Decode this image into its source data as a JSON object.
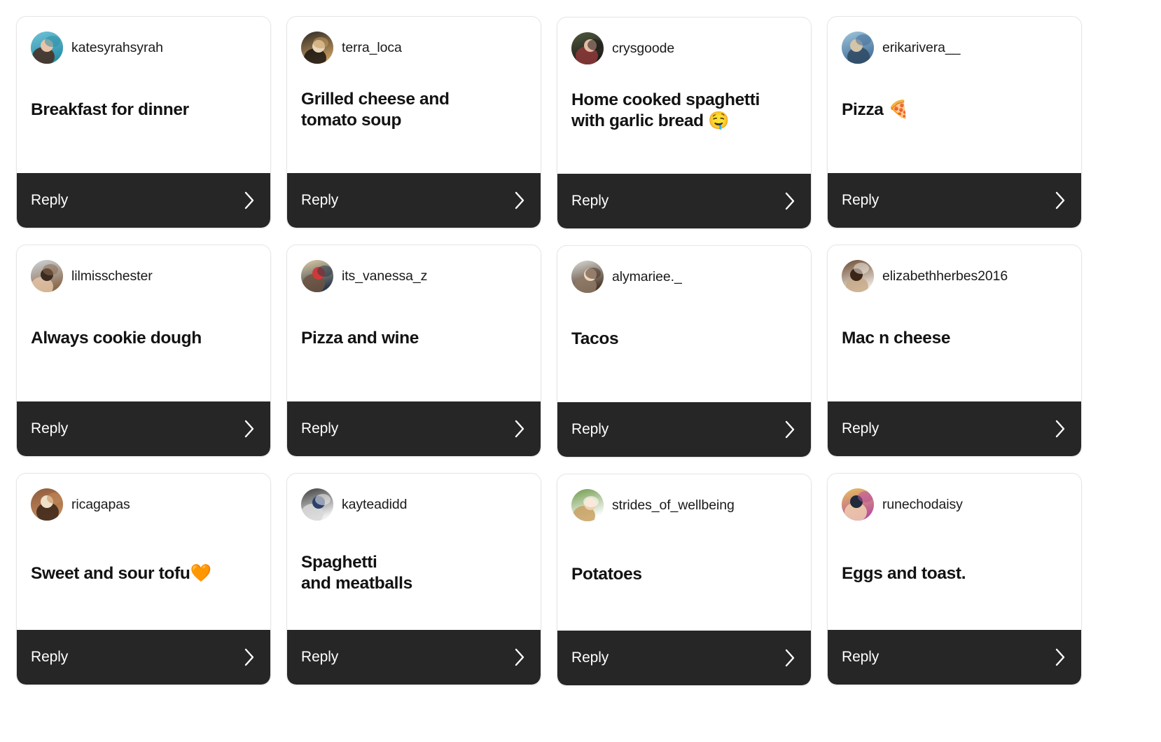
{
  "theme": {
    "page_background": "#ffffff",
    "card_background": "#ffffff",
    "card_border": "#e6e6e6",
    "reply_bar_background": "#262626",
    "reply_label_color": "#ffffff",
    "answer_text_color": "#121212",
    "username_text_color": "#1a1a1a"
  },
  "reply": {
    "label": "Reply",
    "chevron_icon": "chevron-right-icon"
  },
  "grid": {
    "columns": 4,
    "rows": 3,
    "card_count": 12
  },
  "cards": [
    {
      "username": "katesyrahsyrah",
      "answer": "Breakfast for dinner",
      "lines": 1,
      "avatar_icon": "avatar-katesyrahsyrah",
      "avatar_colors": [
        "#6fc3d8",
        "#2b90a8",
        "#e8c4a8",
        "#4a2c1e"
      ]
    },
    {
      "username": "terra_loca",
      "answer": "Grilled cheese and\ntomato soup",
      "lines": 2,
      "avatar_icon": "avatar-terra-loca",
      "avatar_colors": [
        "#2e2a24",
        "#c49a5e",
        "#e8d5b8",
        "#1a1510"
      ]
    },
    {
      "username": "crysgoode",
      "answer": "Home cooked spaghetti\nwith garlic bread 🤤",
      "lines": 2,
      "avatar_icon": "avatar-crysgoode",
      "avatar_colors": [
        "#4f5a3e",
        "#1d1a18",
        "#e6bba4",
        "#8e3a3a"
      ]
    },
    {
      "username": "erikarivera__",
      "answer": "Pizza 🍕",
      "lines": 1,
      "avatar_icon": "avatar-erikarivera",
      "avatar_colors": [
        "#9fc6dc",
        "#46709a",
        "#d4c4a8",
        "#2f4a63"
      ]
    },
    {
      "username": "lilmisschester",
      "answer": "Always cookie dough",
      "lines": 1,
      "avatar_icon": "avatar-lilmisschester",
      "avatar_colors": [
        "#cfd6dc",
        "#8a6a4e",
        "#3b2a20",
        "#e4c3a6"
      ]
    },
    {
      "username": "its_vanessa_z",
      "answer": "Pizza and wine",
      "lines": 1,
      "avatar_icon": "avatar-its-vanessa-z",
      "avatar_colors": [
        "#e2cfa8",
        "#2b3a4a",
        "#cf3a38",
        "#6d5442"
      ]
    },
    {
      "username": "alymariee._",
      "answer": "Tacos",
      "lines": 1,
      "avatar_icon": "avatar-alymariee",
      "avatar_colors": [
        "#dcdcd6",
        "#4a3427",
        "#eed6bc",
        "#8e7a66"
      ]
    },
    {
      "username": "elizabethherbes2016",
      "answer": "Mac n cheese",
      "lines": 1,
      "avatar_icon": "avatar-elizabethherbes2016",
      "avatar_colors": [
        "#6b4a33",
        "#efe7dd",
        "#3a2518",
        "#c8a988"
      ]
    },
    {
      "username": "ricagapas",
      "answer": "Sweet and sour tofu🧡",
      "lines": 1,
      "avatar_icon": "avatar-ricagapas",
      "avatar_colors": [
        "#8c5a3c",
        "#c48a5a",
        "#efe0c8",
        "#3a2418"
      ]
    },
    {
      "username": "kayteadidd",
      "answer": "Spaghetti\nand meatballs",
      "lines": 2,
      "avatar_icon": "avatar-kayteadidd",
      "avatar_colors": [
        "#3c3c3c",
        "#f0f0f0",
        "#2a3f6a",
        "#d8d8d8"
      ]
    },
    {
      "username": "strides_of_wellbeing",
      "answer": "Potatoes",
      "lines": 1,
      "avatar_icon": "avatar-strides-of-wellbeing",
      "avatar_colors": [
        "#6f9a4a",
        "#ffffff",
        "#f0cfae",
        "#c8a060"
      ]
    },
    {
      "username": "runechodaisy",
      "answer": "Eggs and toast.",
      "lines": 1,
      "avatar_icon": "avatar-runechodaisy",
      "avatar_colors": [
        "#e8c35a",
        "#b94fa0",
        "#1f2a3a",
        "#f0cfae"
      ]
    }
  ]
}
